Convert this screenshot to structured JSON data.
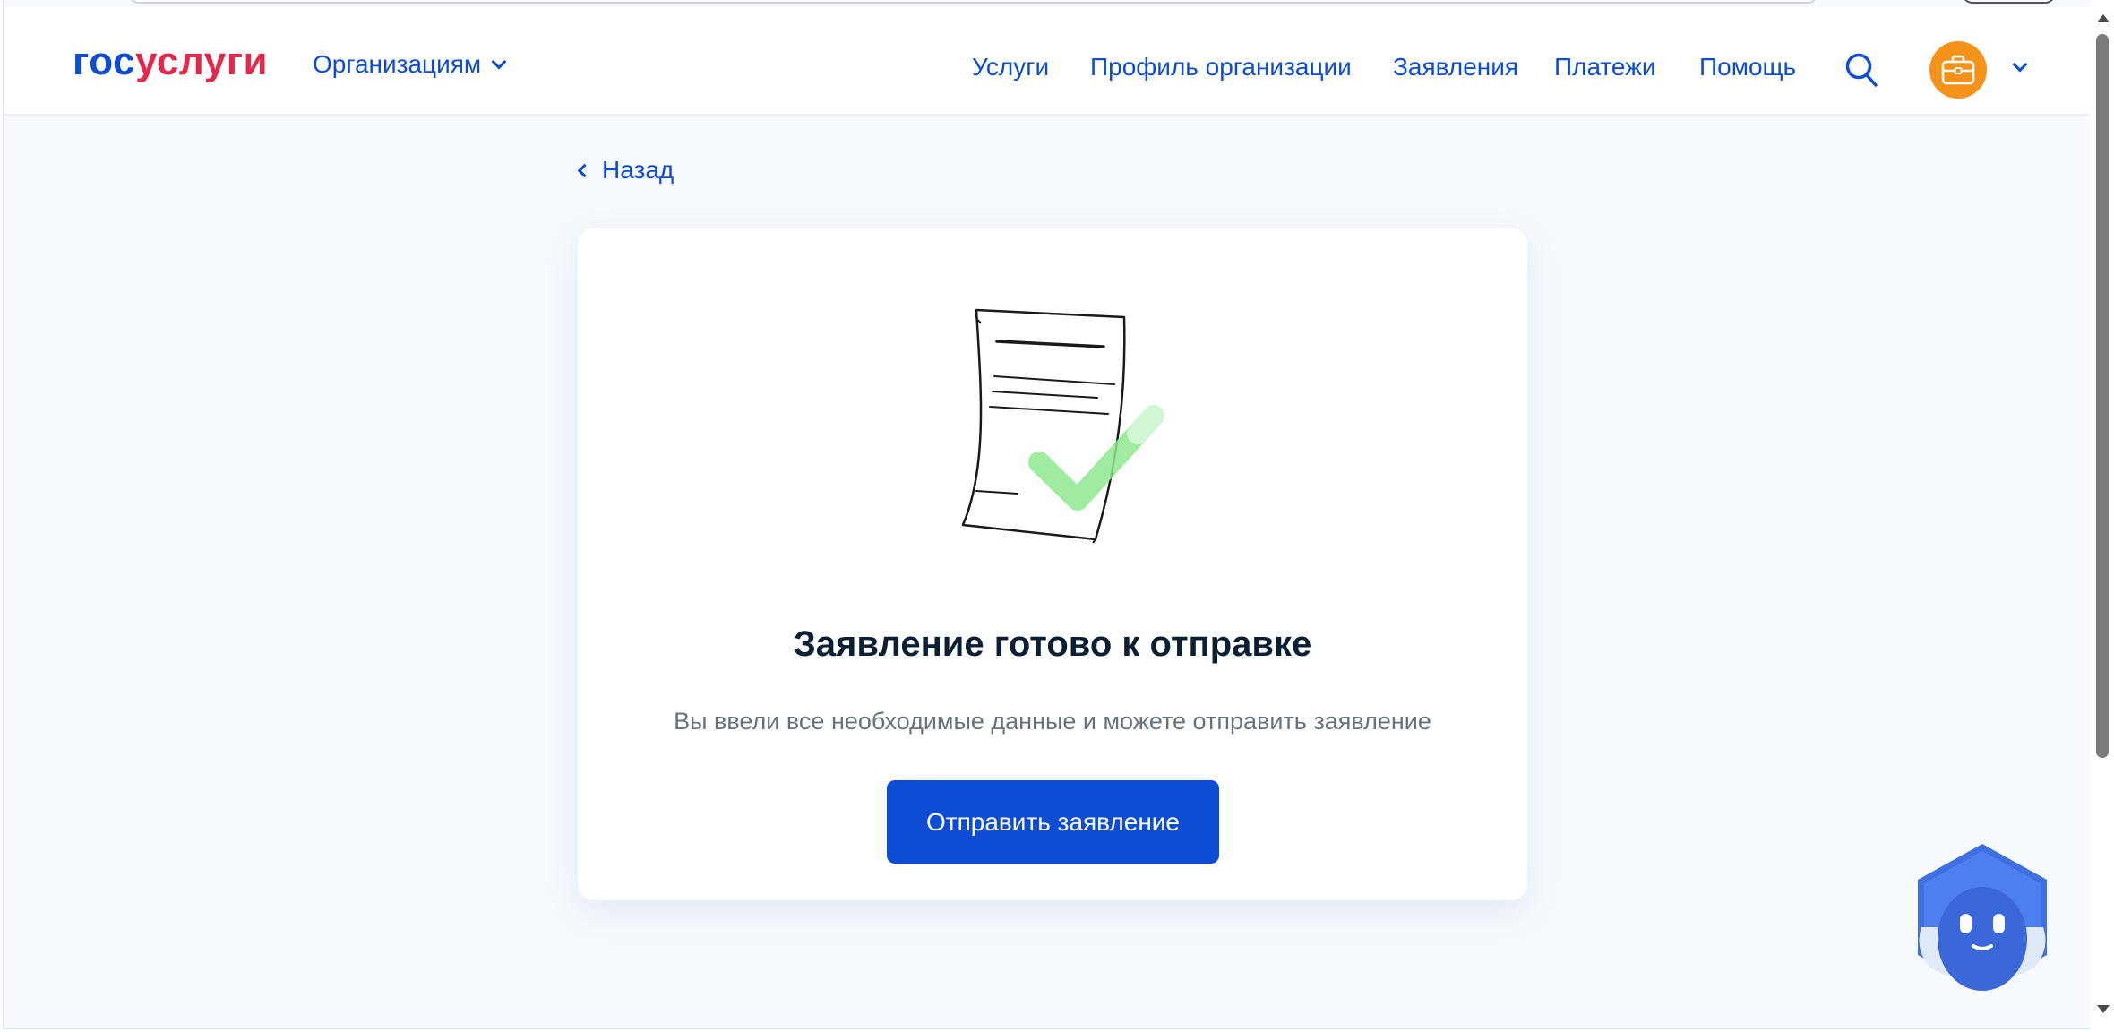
{
  "header": {
    "logo_part1": "гос",
    "logo_part2": "услуги",
    "org_menu_label": "Организациям",
    "nav": [
      {
        "label": "Услуги"
      },
      {
        "label": "Профиль организации"
      },
      {
        "label": "Заявления"
      },
      {
        "label": "Платежи"
      },
      {
        "label": "Помощь"
      }
    ],
    "icons": {
      "search": "search-icon",
      "avatar": "briefcase-icon",
      "dropdown": "chevron-down-icon"
    }
  },
  "back": {
    "label": "Назад"
  },
  "card": {
    "illustration": "document-check-illustration",
    "title": "Заявление готово к отправке",
    "subtitle": "Вы ввели все необходимые данные и можете отправить заявление",
    "button_label": "Отправить заявление"
  },
  "colors": {
    "brand_blue": "#0d4cd3",
    "brand_red": "#e3294b",
    "avatar_orange": "#f4921a",
    "check_green": "#7fe07f",
    "page_bg": "#f6f9fd",
    "title_text": "#0b1f33"
  },
  "assistant": {
    "icon": "chat-robot-icon"
  }
}
